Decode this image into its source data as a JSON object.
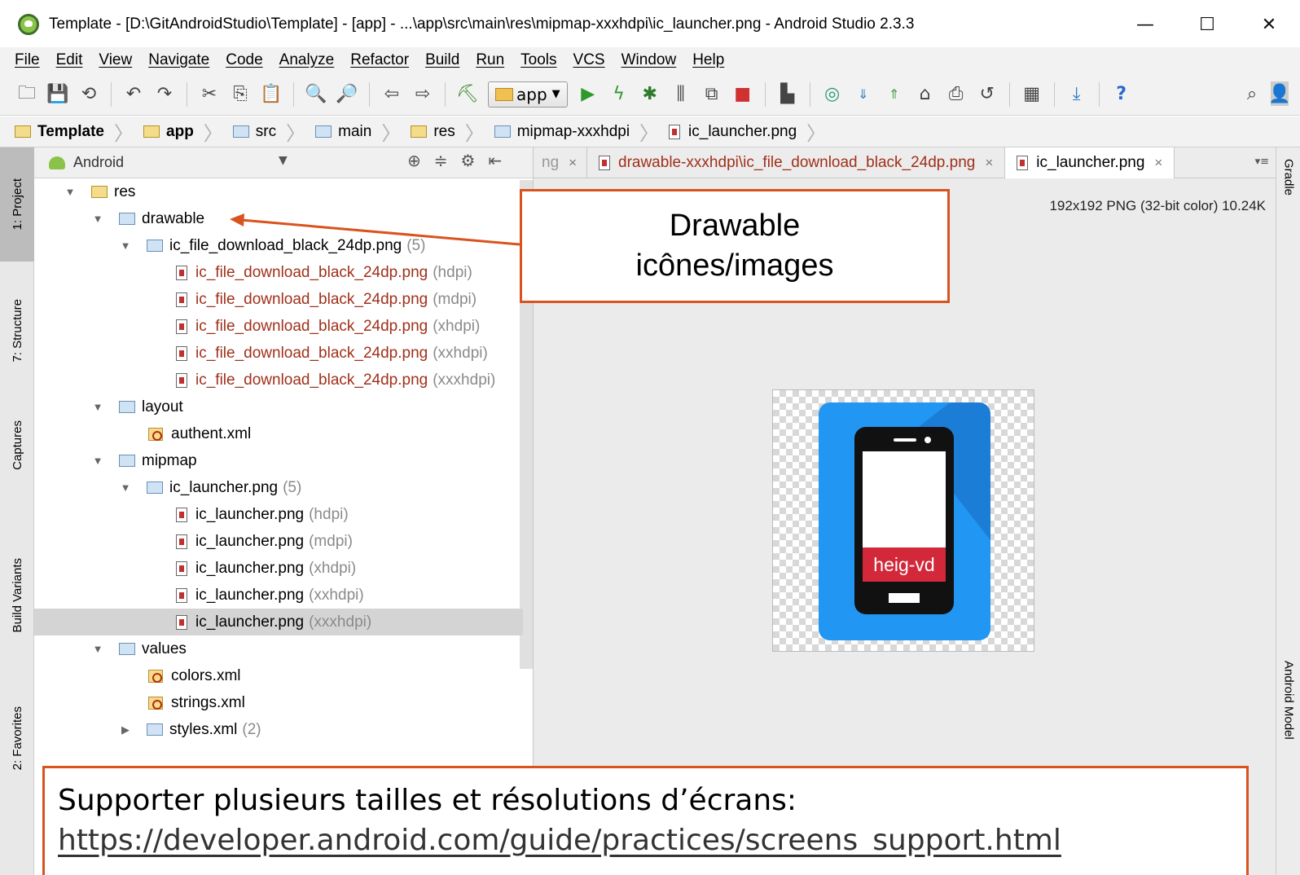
{
  "window": {
    "title": "Template - [D:\\GitAndroidStudio\\Template] - [app] - ...\\app\\src\\main\\res\\mipmap-xxxhdpi\\ic_launcher.png - Android Studio 2.3.3",
    "minimize": "—",
    "maximize": "☐",
    "close": "✕"
  },
  "menu": [
    "File",
    "Edit",
    "View",
    "Navigate",
    "Code",
    "Analyze",
    "Refactor",
    "Build",
    "Run",
    "Tools",
    "VCS",
    "Window",
    "Help"
  ],
  "toolbar": {
    "run_config": "app",
    "help": "?"
  },
  "breadcrumb": [
    "Template",
    "app",
    "src",
    "main",
    "res",
    "mipmap-xxxhdpi",
    "ic_launcher.png"
  ],
  "left_strip": {
    "project": "1: Project",
    "structure": "7: Structure",
    "captures": "Captures",
    "build_variants": "Build Variants",
    "favorites": "2: Favorites"
  },
  "right_strip": {
    "gradle": "Gradle",
    "android_model": "Android Model"
  },
  "project_panel": {
    "view": "Android",
    "tree": [
      {
        "label": "res",
        "qual": "",
        "red": false
      },
      {
        "label": "drawable",
        "qual": "",
        "red": false
      },
      {
        "label": "ic_file_download_black_24dp.png",
        "qual": "(5)",
        "red": false
      },
      {
        "label": "ic_file_download_black_24dp.png",
        "qual": "(hdpi)",
        "red": true
      },
      {
        "label": "ic_file_download_black_24dp.png",
        "qual": "(mdpi)",
        "red": true
      },
      {
        "label": "ic_file_download_black_24dp.png",
        "qual": "(xhdpi)",
        "red": true
      },
      {
        "label": "ic_file_download_black_24dp.png",
        "qual": "(xxhdpi)",
        "red": true
      },
      {
        "label": "ic_file_download_black_24dp.png",
        "qual": "(xxxhdpi)",
        "red": true
      },
      {
        "label": "layout",
        "qual": "",
        "red": false
      },
      {
        "label": "authent.xml",
        "qual": "",
        "red": false
      },
      {
        "label": "mipmap",
        "qual": "",
        "red": false
      },
      {
        "label": "ic_launcher.png",
        "qual": "(5)",
        "red": false
      },
      {
        "label": "ic_launcher.png",
        "qual": "(hdpi)",
        "red": false
      },
      {
        "label": "ic_launcher.png",
        "qual": "(mdpi)",
        "red": false
      },
      {
        "label": "ic_launcher.png",
        "qual": "(xhdpi)",
        "red": false
      },
      {
        "label": "ic_launcher.png",
        "qual": "(xxhdpi)",
        "red": false
      },
      {
        "label": "ic_launcher.png",
        "qual": "(xxxhdpi)",
        "red": false
      },
      {
        "label": "values",
        "qual": "",
        "red": false
      },
      {
        "label": "colors.xml",
        "qual": "",
        "red": false
      },
      {
        "label": "strings.xml",
        "qual": "",
        "red": false
      },
      {
        "label": "styles.xml",
        "qual": "(2)",
        "red": false
      }
    ]
  },
  "editor_tabs": [
    {
      "label": "ng",
      "close": "×"
    },
    {
      "label": "drawable-xxxhdpi\\ic_file_download_black_24dp.png",
      "close": "×"
    },
    {
      "label": "ic_launcher.png",
      "close": "×"
    }
  ],
  "editor": {
    "image_info": "192x192 PNG (32-bit color) 10.24K",
    "launcher_label": "heig-vd"
  },
  "callout": {
    "line1": "Drawable",
    "line2": "icônes/images"
  },
  "bottom_callout": {
    "text": "Supporter plusieurs tailles et résolutions d’écrans:",
    "link": "https://developer.android.com/guide/practices/screens_support.html"
  },
  "colors": {
    "callout_border": "#d9531e",
    "launcher_bg": "#2196f3",
    "label_red": "#d2283a"
  }
}
